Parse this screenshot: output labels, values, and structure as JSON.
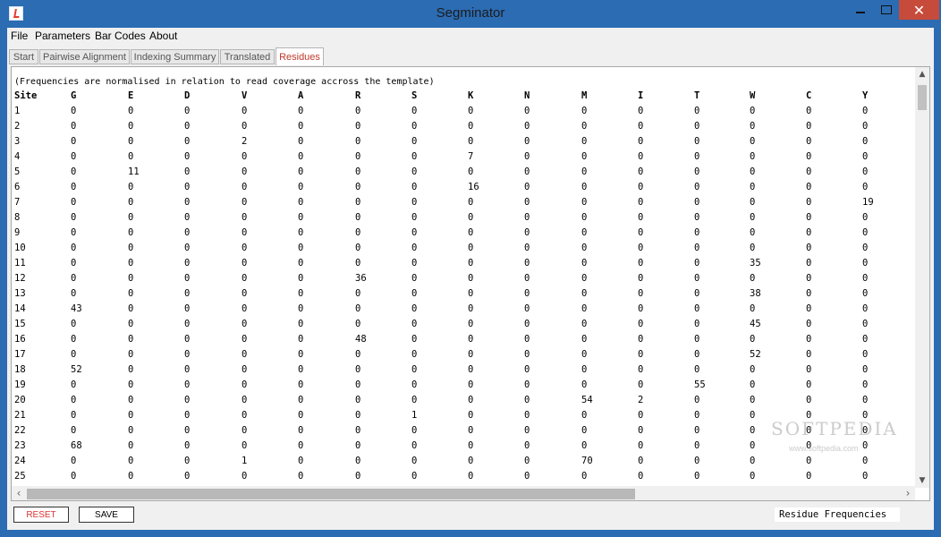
{
  "window": {
    "title": "Segminator"
  },
  "menu": [
    "File",
    "Parameters",
    "Bar Codes",
    "About"
  ],
  "tabs": [
    "Start",
    "Pairwise Alignment",
    "Indexing Summary",
    "Translated",
    "Residues"
  ],
  "active_tab": "Residues",
  "residues": {
    "note": "(Frequencies are normalised in relation to read coverage accross the template)",
    "columns": [
      "Site",
      "G",
      "E",
      "D",
      "V",
      "A",
      "R",
      "S",
      "K",
      "N",
      "M",
      "I",
      "T",
      "W",
      "C",
      "Y"
    ],
    "rows": [
      [
        "1",
        "0",
        "0",
        "0",
        "0",
        "0",
        "0",
        "0",
        "0",
        "0",
        "0",
        "0",
        "0",
        "0",
        "0",
        "0"
      ],
      [
        "2",
        "0",
        "0",
        "0",
        "0",
        "0",
        "0",
        "0",
        "0",
        "0",
        "0",
        "0",
        "0",
        "0",
        "0",
        "0"
      ],
      [
        "3",
        "0",
        "0",
        "0",
        "2",
        "0",
        "0",
        "0",
        "0",
        "0",
        "0",
        "0",
        "0",
        "0",
        "0",
        "0"
      ],
      [
        "4",
        "0",
        "0",
        "0",
        "0",
        "0",
        "0",
        "0",
        "7",
        "0",
        "0",
        "0",
        "0",
        "0",
        "0",
        "0"
      ],
      [
        "5",
        "0",
        "11",
        "0",
        "0",
        "0",
        "0",
        "0",
        "0",
        "0",
        "0",
        "0",
        "0",
        "0",
        "0",
        "0"
      ],
      [
        "6",
        "0",
        "0",
        "0",
        "0",
        "0",
        "0",
        "0",
        "16",
        "0",
        "0",
        "0",
        "0",
        "0",
        "0",
        "0"
      ],
      [
        "7",
        "0",
        "0",
        "0",
        "0",
        "0",
        "0",
        "0",
        "0",
        "0",
        "0",
        "0",
        "0",
        "0",
        "0",
        "19"
      ],
      [
        "8",
        "0",
        "0",
        "0",
        "0",
        "0",
        "0",
        "0",
        "0",
        "0",
        "0",
        "0",
        "0",
        "0",
        "0",
        "0"
      ],
      [
        "9",
        "0",
        "0",
        "0",
        "0",
        "0",
        "0",
        "0",
        "0",
        "0",
        "0",
        "0",
        "0",
        "0",
        "0",
        "0"
      ],
      [
        "10",
        "0",
        "0",
        "0",
        "0",
        "0",
        "0",
        "0",
        "0",
        "0",
        "0",
        "0",
        "0",
        "0",
        "0",
        "0"
      ],
      [
        "11",
        "0",
        "0",
        "0",
        "0",
        "0",
        "0",
        "0",
        "0",
        "0",
        "0",
        "0",
        "0",
        "35",
        "0",
        "0"
      ],
      [
        "12",
        "0",
        "0",
        "0",
        "0",
        "0",
        "36",
        "0",
        "0",
        "0",
        "0",
        "0",
        "0",
        "0",
        "0",
        "0"
      ],
      [
        "13",
        "0",
        "0",
        "0",
        "0",
        "0",
        "0",
        "0",
        "0",
        "0",
        "0",
        "0",
        "0",
        "38",
        "0",
        "0"
      ],
      [
        "14",
        "43",
        "0",
        "0",
        "0",
        "0",
        "0",
        "0",
        "0",
        "0",
        "0",
        "0",
        "0",
        "0",
        "0",
        "0"
      ],
      [
        "15",
        "0",
        "0",
        "0",
        "0",
        "0",
        "0",
        "0",
        "0",
        "0",
        "0",
        "0",
        "0",
        "45",
        "0",
        "0"
      ],
      [
        "16",
        "0",
        "0",
        "0",
        "0",
        "0",
        "48",
        "0",
        "0",
        "0",
        "0",
        "0",
        "0",
        "0",
        "0",
        "0"
      ],
      [
        "17",
        "0",
        "0",
        "0",
        "0",
        "0",
        "0",
        "0",
        "0",
        "0",
        "0",
        "0",
        "0",
        "52",
        "0",
        "0"
      ],
      [
        "18",
        "52",
        "0",
        "0",
        "0",
        "0",
        "0",
        "0",
        "0",
        "0",
        "0",
        "0",
        "0",
        "0",
        "0",
        "0"
      ],
      [
        "19",
        "0",
        "0",
        "0",
        "0",
        "0",
        "0",
        "0",
        "0",
        "0",
        "0",
        "0",
        "55",
        "0",
        "0",
        "0"
      ],
      [
        "20",
        "0",
        "0",
        "0",
        "0",
        "0",
        "0",
        "0",
        "0",
        "0",
        "54",
        "2",
        "0",
        "0",
        "0",
        "0"
      ],
      [
        "21",
        "0",
        "0",
        "0",
        "0",
        "0",
        "0",
        "1",
        "0",
        "0",
        "0",
        "0",
        "0",
        "0",
        "0",
        "0"
      ],
      [
        "22",
        "0",
        "0",
        "0",
        "0",
        "0",
        "0",
        "0",
        "0",
        "0",
        "0",
        "0",
        "0",
        "0",
        "0",
        "0"
      ],
      [
        "23",
        "68",
        "0",
        "0",
        "0",
        "0",
        "0",
        "0",
        "0",
        "0",
        "0",
        "0",
        "0",
        "0",
        "0",
        "0"
      ],
      [
        "24",
        "0",
        "0",
        "0",
        "1",
        "0",
        "0",
        "0",
        "0",
        "0",
        "70",
        "0",
        "0",
        "0",
        "0",
        "0"
      ],
      [
        "25",
        "0",
        "0",
        "0",
        "0",
        "0",
        "0",
        "0",
        "0",
        "0",
        "0",
        "0",
        "0",
        "0",
        "0",
        "0"
      ]
    ]
  },
  "buttons": {
    "reset": "RESET",
    "save": "SAVE"
  },
  "status": "Residue Frequencies",
  "watermark": {
    "logo": "SOFTPEDIA",
    "url": "www.softpedia.com"
  },
  "icons": {
    "app": "java-app-icon",
    "minimize": "minimize-icon",
    "maximize": "maximize-icon",
    "close": "close-icon"
  },
  "colors": {
    "titlebar": "#2b6cb3",
    "close": "#c74b3b",
    "active_tab_text": "#c0392b",
    "reset_text": "#dd3333"
  }
}
